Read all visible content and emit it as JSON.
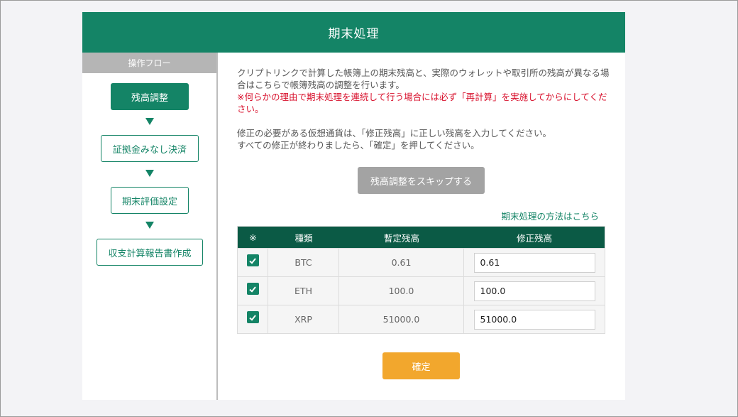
{
  "header": {
    "title": "期末処理"
  },
  "sidebar": {
    "heading": "操作フロー",
    "steps": [
      {
        "label": "残高調整",
        "active": true
      },
      {
        "label": "証拠金みなし決済",
        "active": false
      },
      {
        "label": "期末評価設定",
        "active": false
      },
      {
        "label": "収支計算報告書作成",
        "active": false
      }
    ]
  },
  "main": {
    "desc": "クリプトリンクで計算した帳簿上の期末残高と、実際のウォレットや取引所の残高が異なる場合はこちらで帳簿残高の調整を行います。",
    "warning": "※何らかの理由で期末処理を連続して行う場合には必ず「再計算」を実施してからにしてください。",
    "instruction1": "修正の必要がある仮想通貨は、「修正残高」に正しい残高を入力してください。",
    "instruction2": "すべての修正が終わりましたら、「確定」を押してください。",
    "skip_button": "残高調整をスキップする",
    "method_link": "期末処理の方法はこちら",
    "confirm_button": "確定"
  },
  "table": {
    "headers": [
      "※",
      "種類",
      "暫定残高",
      "修正残高"
    ],
    "rows": [
      {
        "checked": true,
        "type": "BTC",
        "provisional": "0.61",
        "corrected": "0.61"
      },
      {
        "checked": true,
        "type": "ETH",
        "provisional": "100.0",
        "corrected": "100.0"
      },
      {
        "checked": true,
        "type": "XRP",
        "provisional": "51000.0",
        "corrected": "51000.0"
      }
    ]
  },
  "colors": {
    "primary": "#148466",
    "table_header": "#0b5a45",
    "warning": "#d8102c",
    "confirm": "#f2a72d",
    "skip": "#a3a3a3"
  }
}
